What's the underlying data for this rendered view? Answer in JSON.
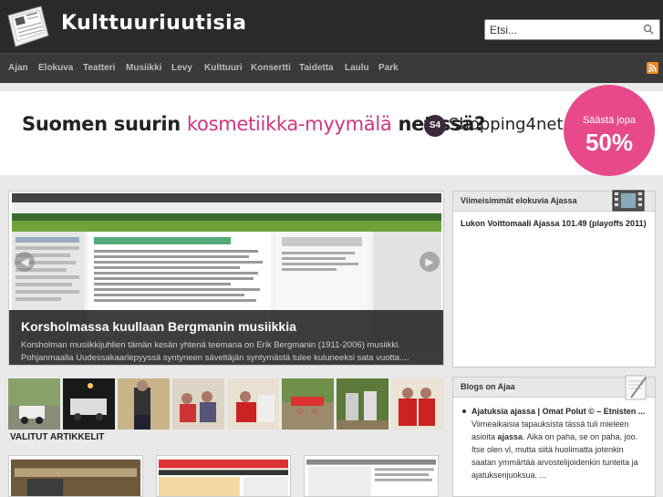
{
  "header": {
    "site_title": "Kulttuuriuutisia",
    "search_placeholder": "Etsi..."
  },
  "nav": {
    "items": [
      "Ajan",
      "Elokuva",
      "Teatteri",
      "Musiikki",
      "Levy",
      "Kulttuuri",
      "Konsertti",
      "Taidetta",
      "Laulu",
      "Park"
    ]
  },
  "banner": {
    "text_1": "Suomen suurin ",
    "text_2": "kosmetiikka-myymälä",
    "text_3": " netissä?",
    "logo_mark": "S4",
    "brand": "Shopping4net",
    "promo_line1": "Säästä jopa",
    "promo_line2": "50%"
  },
  "slider": {
    "title": "Korsholmassa kuullaan Bergmanin musiikkia",
    "excerpt": "Korsholman musiikkijuhlien tämän kesän yhtenä teemana on Erik Bergmanin (1911-2006) musiikki. Pohjanmaalla Uudessakaarlepyyssä syntyneen säveltäjän syntymästä tulee kuluneeksi sata vuotta...."
  },
  "featured": {
    "label": "VALITUT ARTIKKELIT"
  },
  "sidebar": {
    "movies_title": "Viimeisimmät elokuvia Ajassa",
    "movies_item": "Lukon Voittomaali Ajassa 101.49 (playoffs 2011)",
    "blogs_title": "Blogs on Ajaa",
    "blog_item_title": "Ajatuksia ajassa | Omat Polut © – Etnisten ...",
    "blog_item_text_1": "Itse olen vl, mutta siitä huolimatta jotenkin saatan ymmärtää arvostelijoidenkin tunteita ja ajatuksenjuoksua. ...",
    "blog_item_pre": "Viimeaikaisia tapauksista tässä tuli mieleen asioita ",
    "blog_item_bold": "ajassa",
    "blog_item_post": ". Aika on paha, se on paha, joo."
  },
  "colors": {
    "header_bg": "#2a2a2a",
    "nav_bg": "#3a3a3a",
    "accent_pink": "#d2357f",
    "rss": "#f08a24"
  }
}
